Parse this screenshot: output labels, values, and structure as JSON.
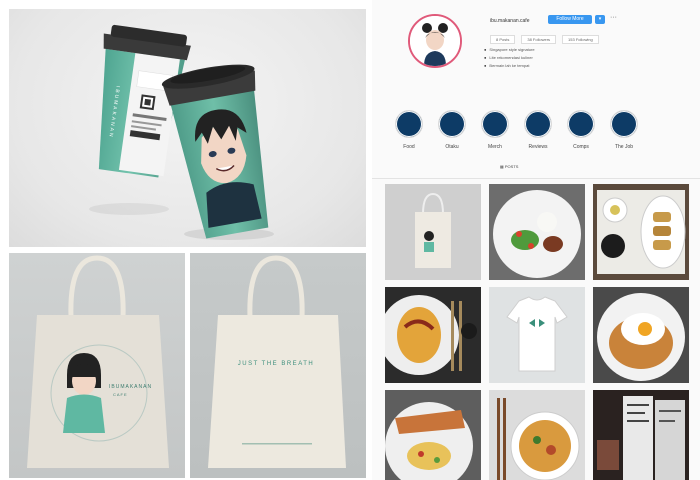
{
  "profile": {
    "username": "ibu.makanan.cafe",
    "follow_label": "Follow More",
    "dropdown_label": "▾",
    "more_label": "···",
    "stats": [
      "8 Posts",
      "38 Followers",
      "153 Following"
    ],
    "bio": [
      "Singapore style signature",
      "Lite rekomendasi kuliner",
      "Bermain lah ke tempat"
    ],
    "highlights": [
      "Food",
      "Otaku",
      "Merch",
      "Reviews",
      "Comps",
      "The Job"
    ],
    "tab_label": "▦ POSTS"
  },
  "mockups": {
    "tote_text": "JUST THE BREATH"
  },
  "colors": {
    "teal": "#5fb8a2",
    "navy": "#0d3b66",
    "lid": "#3a3a3a",
    "instagram_blue": "#3897f0"
  }
}
